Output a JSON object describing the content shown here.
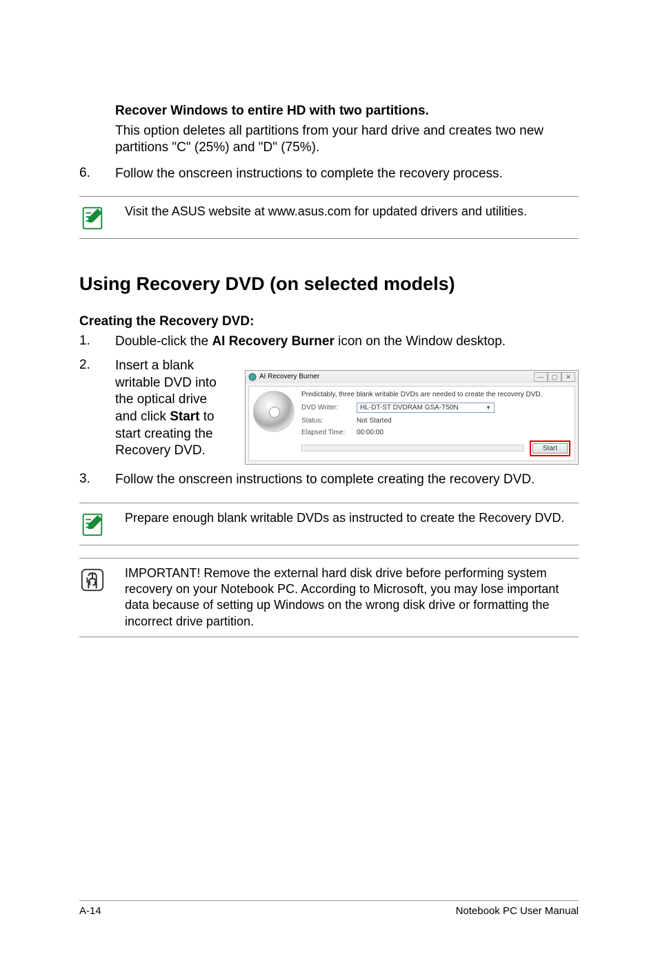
{
  "recover_heading": "Recover Windows to entire HD with two partitions.",
  "recover_desc": "This option deletes all partitions from your hard drive and creates two new partitions \"C\" (25%) and \"D\" (75%).",
  "step6_num": "6.",
  "step6_text": "Follow the onscreen instructions to complete the recovery process.",
  "note1_text": "Visit the ASUS website at www.asus.com for updated drivers and utilities.",
  "section_title": "Using Recovery DVD (on selected models)",
  "create_heading": "Creating the Recovery DVD:",
  "step1_num": "1.",
  "step1_pre": "Double-click the ",
  "step1_bold": "AI Recovery Burner",
  "step1_post": " icon on the Window desktop.",
  "step2_num": "2.",
  "step2_pre": "Insert a blank writable DVD into the optical drive and click ",
  "step2_bold": "Start",
  "step2_post": " to start creating the Recovery DVD.",
  "ai_window": {
    "title": "AI Recovery Burner",
    "msg": "Predictably, three blank writable DVDs are needed to create the recovery DVD.",
    "writer_label": "DVD Writer:",
    "writer_value": "HL-DT-ST DVDRAM GSA-T50N",
    "status_label": "Status:",
    "status_value": "Not Started",
    "elapsed_label": "Elapsed Time:",
    "elapsed_value": "00:00:00",
    "start_btn": "Start"
  },
  "step3_num": "3.",
  "step3_text": "Follow the onscreen instructions to complete creating the recovery DVD.",
  "note2_text": "Prepare enough blank writable DVDs as instructed to create the Recovery DVD.",
  "note3_text": "IMPORTANT! Remove the external hard disk drive before performing system recovery on your Notebook PC. According to Microsoft, you may lose important data because of setting up Windows on the wrong disk drive or formatting the incorrect drive partition.",
  "footer_left": "A-14",
  "footer_right": "Notebook PC User Manual"
}
